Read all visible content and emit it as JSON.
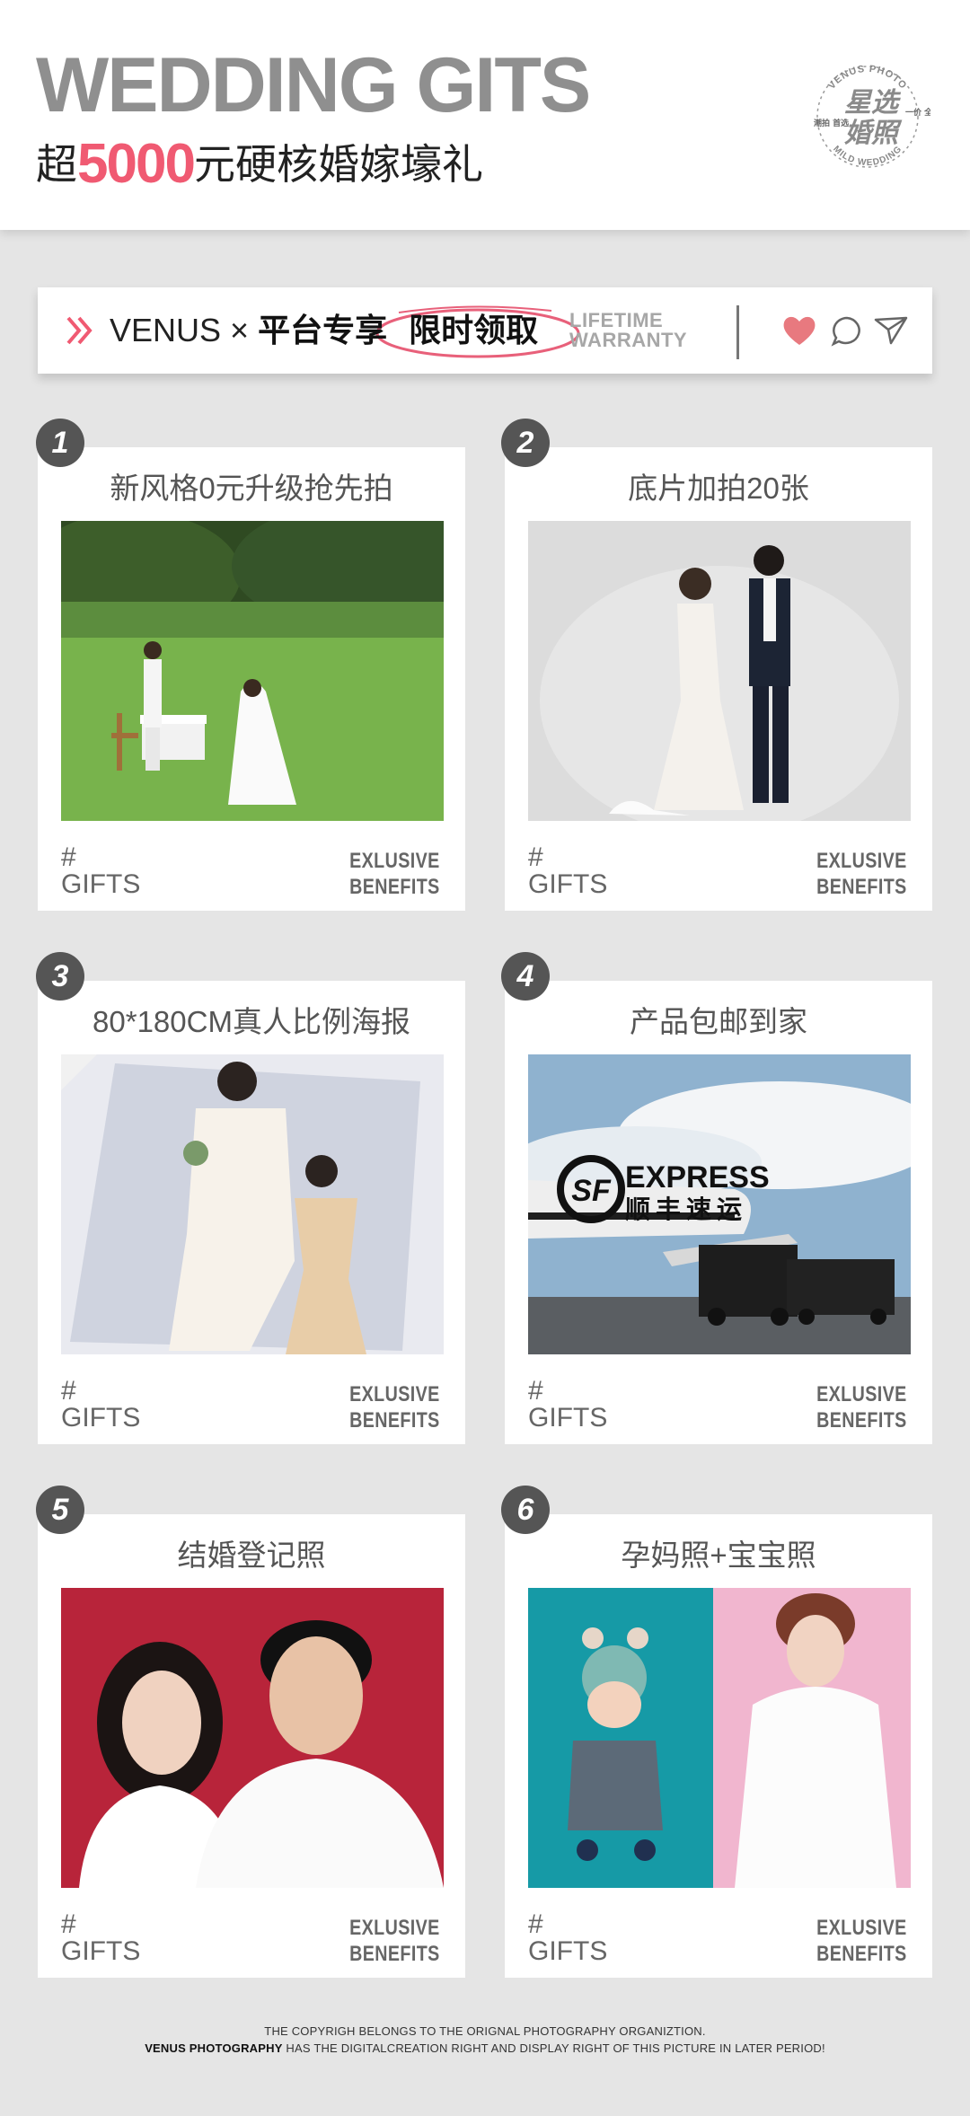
{
  "header": {
    "title": "WEDDING GITS",
    "subtitle_prefix": "超",
    "subtitle_number": "5000",
    "subtitle_suffix": "元硬核婚嫁壕礼",
    "seal": {
      "ring_top": "VENUS PHOTO",
      "ring_bottom": "MILD WEDDING",
      "main_line1": "星选",
      "main_line2": "婚照",
      "left_small": "潮拍 首选",
      "right_small": "一价 全包"
    }
  },
  "bar": {
    "brand": "VENUS",
    "times": "×",
    "platform": "平台专享",
    "limited": "限时领取",
    "lifetime": "LIFETIME",
    "warranty": "WARRANTY",
    "icons": [
      "heart-icon",
      "chat-icon",
      "send-icon"
    ]
  },
  "colors": {
    "accent": "#f05a72",
    "title_gray": "#8f8f8f",
    "badge": "#555555",
    "background": "#e5e5e5"
  },
  "cards": [
    {
      "number": "1",
      "title": "新风格0元升级抢先拍",
      "hash": "#",
      "gifts": "GIFTS",
      "exclusive": "EXLUSIVE",
      "benefits": "BENEFITS"
    },
    {
      "number": "2",
      "title": "底片加拍20张",
      "hash": "#",
      "gifts": "GIFTS",
      "exclusive": "EXLUSIVE",
      "benefits": "BENEFITS"
    },
    {
      "number": "3",
      "title": "80*180CM真人比例海报",
      "hash": "#",
      "gifts": "GIFTS",
      "exclusive": "EXLUSIVE",
      "benefits": "BENEFITS"
    },
    {
      "number": "4",
      "title": "产品包邮到家",
      "hash": "#",
      "gifts": "GIFTS",
      "exclusive": "EXLUSIVE",
      "benefits": "BENEFITS",
      "photo_text": {
        "express": "EXPRESS",
        "sf_cn": "顺丰速运",
        "logo": "SF"
      }
    },
    {
      "number": "5",
      "title": "结婚登记照",
      "hash": "#",
      "gifts": "GIFTS",
      "exclusive": "EXLUSIVE",
      "benefits": "BENEFITS"
    },
    {
      "number": "6",
      "title": "孕妈照+宝宝照",
      "hash": "#",
      "gifts": "GIFTS",
      "exclusive": "EXLUSIVE",
      "benefits": "BENEFITS"
    }
  ],
  "footer": {
    "line1": "THE COPYRIGH BELONGS TO THE ORIGNAL PHOTOGRAPHY ORGANIZTION.",
    "line2_bold": "VENUS PHOTOGRAPHY",
    "line2_rest": " HAS THE DIGITALCREATION RIGHT AND DISPLAY RIGHT OF THIS PICTURE IN LATER PERIOD!"
  }
}
